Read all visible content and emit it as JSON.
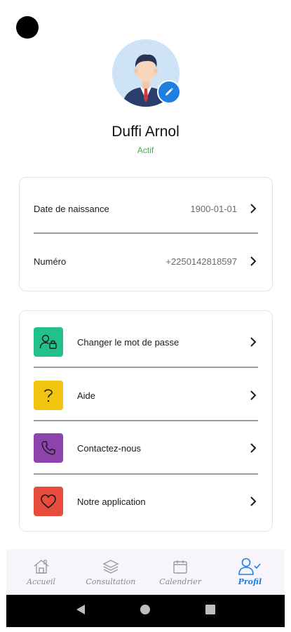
{
  "profile": {
    "name": "Duffi Arnol",
    "status": "Actif"
  },
  "info": [
    {
      "label": "Date de naissance",
      "value": "1900-01-01"
    },
    {
      "label": "Numéro",
      "value": "+2250142818597"
    }
  ],
  "menu": [
    {
      "label": "Changer le mot de passe",
      "icon": "user-lock-icon",
      "color": "#22c08a"
    },
    {
      "label": "Aide",
      "icon": "question-icon",
      "color": "#f1c40f"
    },
    {
      "label": "Contactez-nous",
      "icon": "phone-icon",
      "color": "#8e44ad"
    },
    {
      "label": "Notre application",
      "icon": "heart-icon",
      "color": "#e74c3c"
    }
  ],
  "nav": [
    {
      "label": "Accueil",
      "icon": "home-icon",
      "active": false
    },
    {
      "label": "Consultation",
      "icon": "layers-icon",
      "active": false
    },
    {
      "label": "Calendrier",
      "icon": "calendar-icon",
      "active": false
    },
    {
      "label": "Profil",
      "icon": "user-check-icon",
      "active": true
    }
  ],
  "colors": {
    "accent": "#1d7fe0",
    "status_active": "#3fae4a"
  }
}
